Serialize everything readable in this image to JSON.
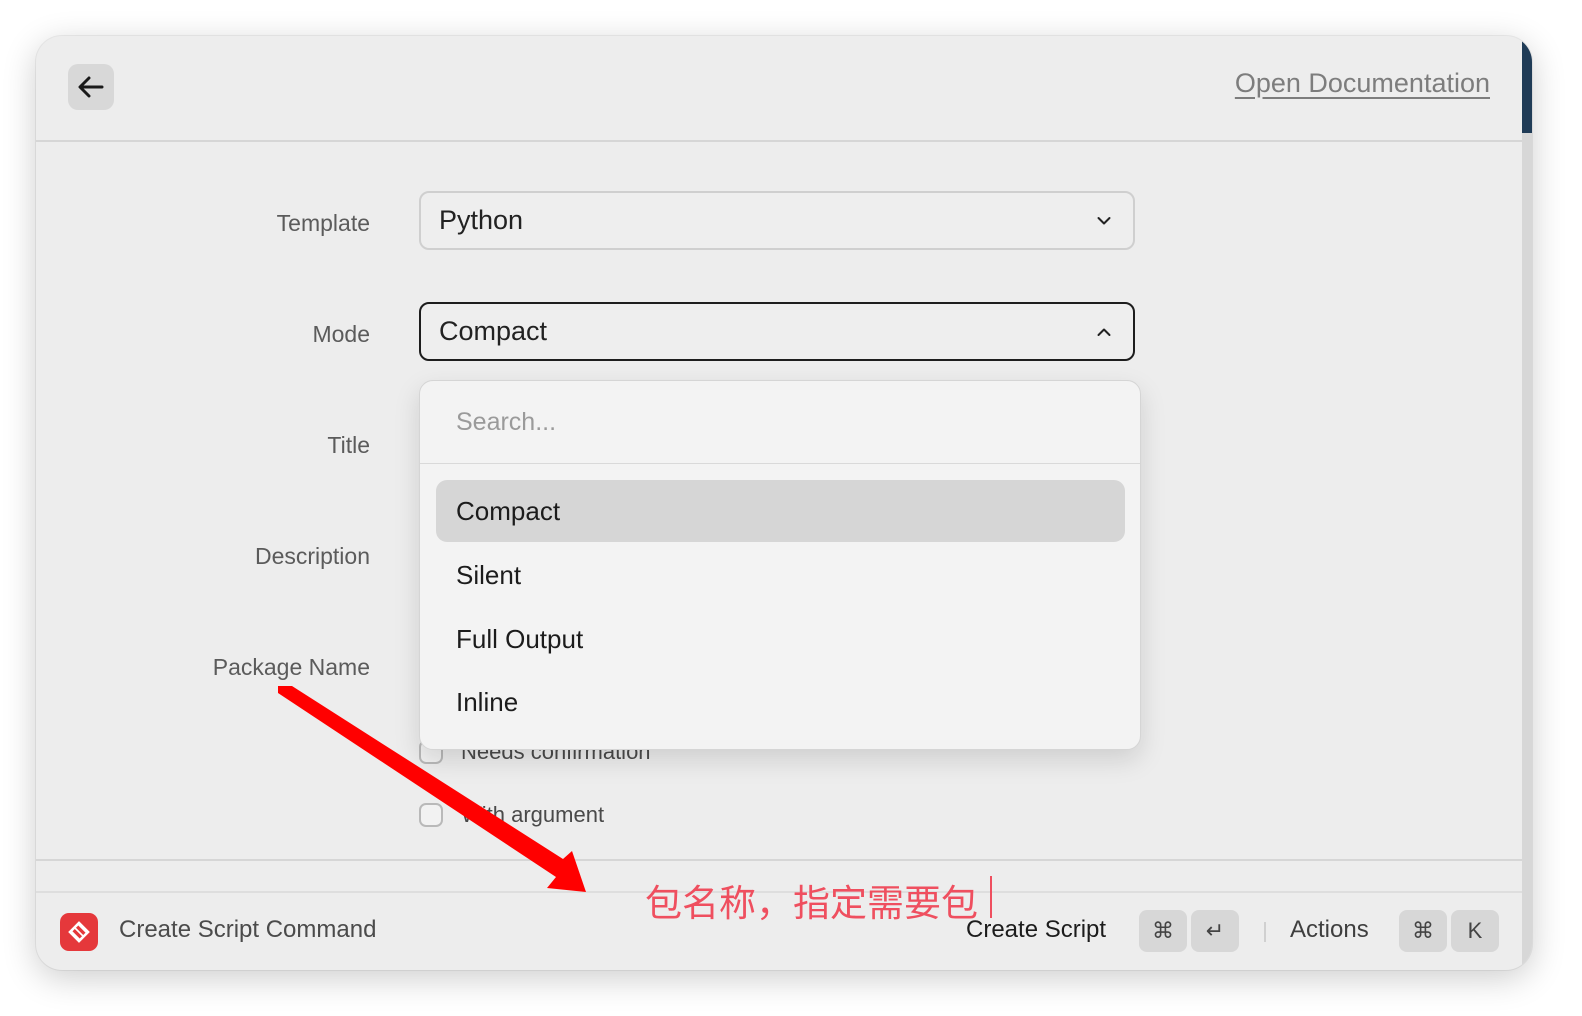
{
  "header": {
    "back_icon": "arrow-left-icon",
    "doc_link": "Open Documentation"
  },
  "form": {
    "template": {
      "label": "Template",
      "value": "Python"
    },
    "mode": {
      "label": "Mode",
      "value": "Compact"
    },
    "title_label": "Title",
    "description_label": "Description",
    "package_name_label": "Package Name",
    "checkboxes": [
      {
        "label": "Needs confirmation",
        "checked": false
      },
      {
        "label": "With argument",
        "checked": false
      }
    ]
  },
  "dropdown": {
    "search_placeholder": "Search...",
    "options": [
      "Compact",
      "Silent",
      "Full Output",
      "Inline"
    ],
    "selected": "Compact"
  },
  "footer": {
    "app_icon": "raycast-icon",
    "title": "Create Script Command",
    "primary_action": "Create Script",
    "primary_keys": [
      "⌘",
      "↵"
    ],
    "actions_label": "Actions",
    "actions_keys": [
      "⌘",
      "K"
    ]
  },
  "annotation": {
    "text": "包名称，指定需要包",
    "color": "#ef4f5f"
  }
}
